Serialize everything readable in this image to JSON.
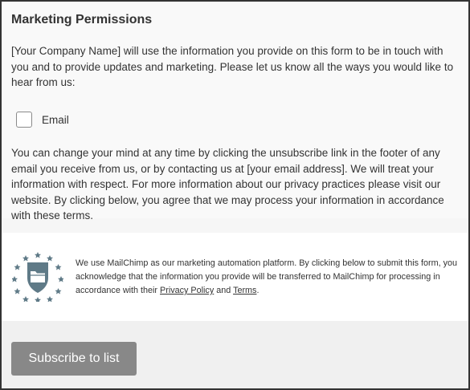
{
  "form": {
    "title": "Marketing Permissions",
    "intro": "[Your Company Name] will use the information you provide on this form to be in touch with you and to provide updates and marketing. Please let us know all the ways you would like to hear from us:",
    "options": [
      {
        "label": "Email",
        "checked": false
      }
    ],
    "note": "You can change your mind at any time by clicking the unsubscribe link in the footer of any email you receive from us, or by contacting us at [your email address]. We will treat your information with respect. For more information about our privacy practices please visit our website. By clicking below, you agree that we may process your information in accordance with these terms."
  },
  "mailchimp": {
    "icon": "mailchimp-gdpr-shield-icon",
    "text_before": "We use MailChimp as our marketing automation platform. By clicking below to submit this form, you acknowledge that the information you provide will be transferred to MailChimp for processing in accordance with their ",
    "privacy_link": "Privacy Policy",
    "and": " and ",
    "terms_link": "Terms",
    "text_after": "."
  },
  "footer": {
    "subscribe_label": "Subscribe to list"
  },
  "colors": {
    "button": "#888888",
    "shield": "#5f7a87",
    "background": "#f6f6f6"
  }
}
